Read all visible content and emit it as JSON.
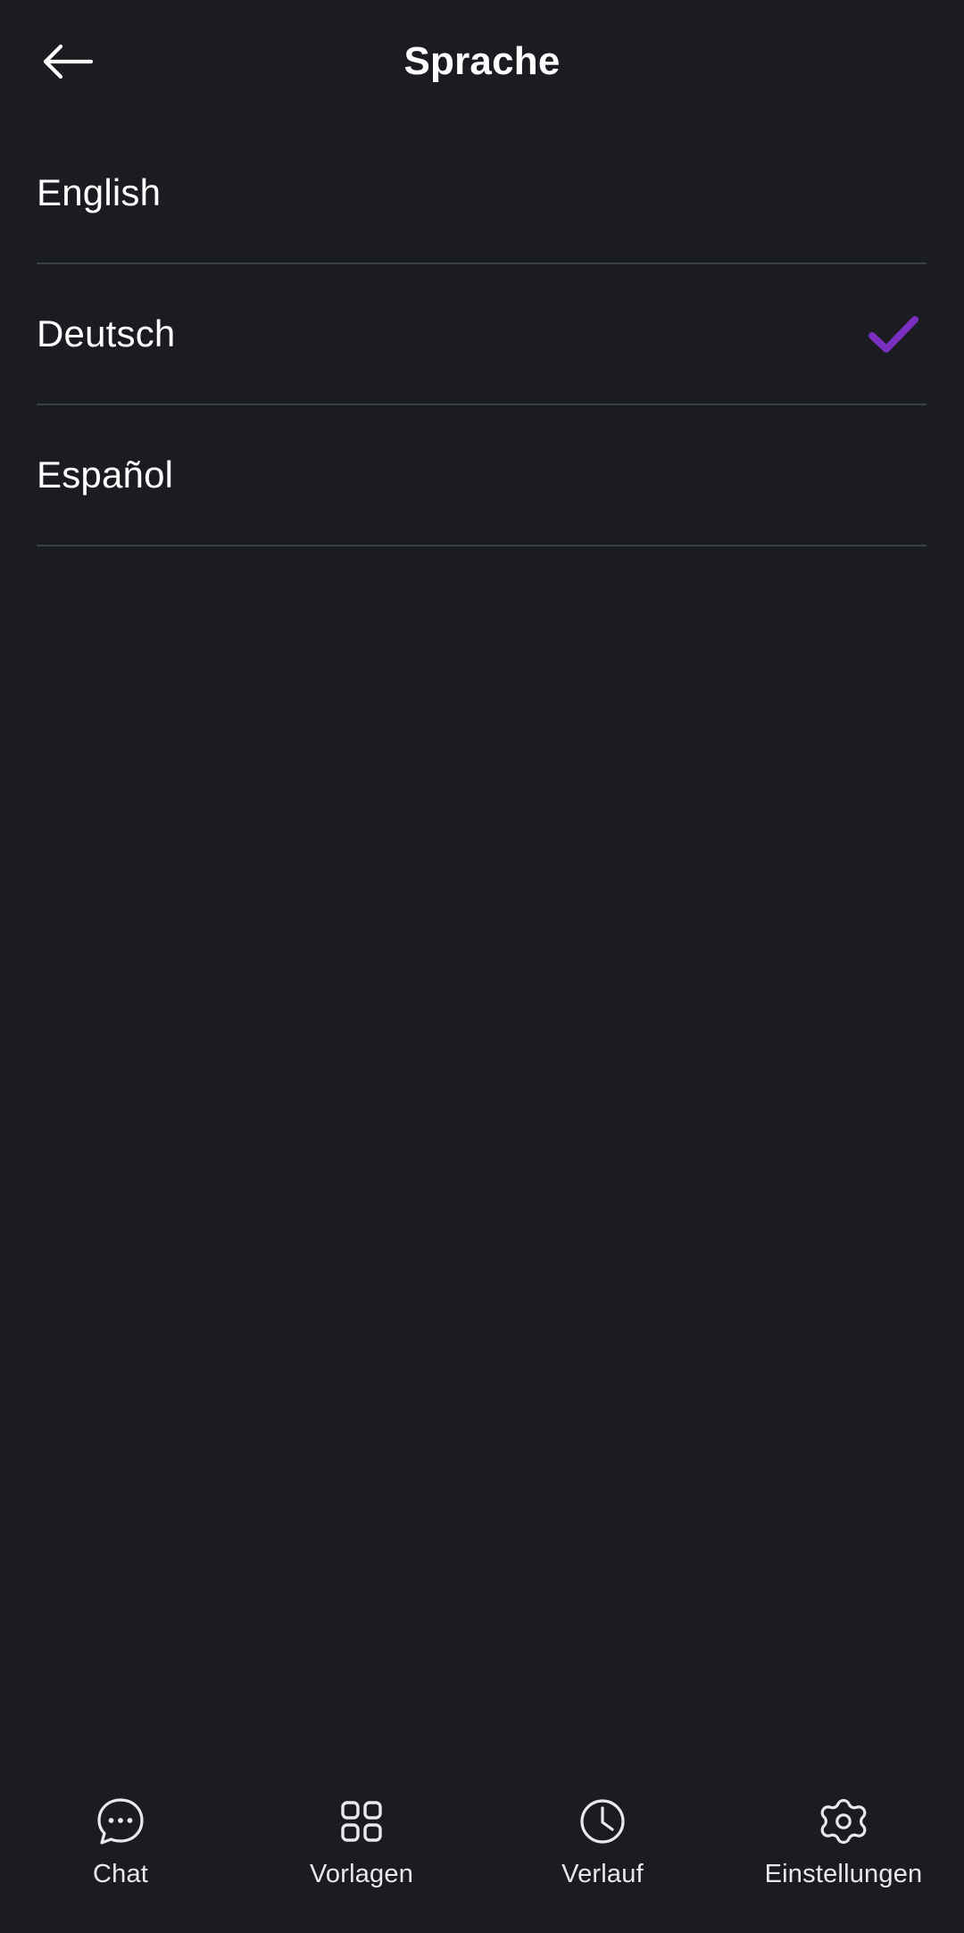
{
  "theme": {
    "background": "#1a1c21",
    "text": "#ffffff",
    "divider": "#3b3f47",
    "accent": "#7a2fc0",
    "nav_label": "#e8e9ec"
  },
  "header": {
    "title": "Sprache",
    "back_icon": "arrow-left-icon"
  },
  "language_list": {
    "items": [
      {
        "label": "English",
        "selected": false
      },
      {
        "label": "Deutsch",
        "selected": true
      },
      {
        "label": "Español",
        "selected": false
      }
    ],
    "selected_icon": "check-icon"
  },
  "bottom_nav": {
    "items": [
      {
        "label": "Chat",
        "icon": "chat-bubble-icon",
        "active": false
      },
      {
        "label": "Vorlagen",
        "icon": "grid-squares-icon",
        "active": false
      },
      {
        "label": "Verlauf",
        "icon": "clock-icon",
        "active": false
      },
      {
        "label": "Einstellungen",
        "icon": "gear-icon",
        "active": false
      }
    ]
  }
}
